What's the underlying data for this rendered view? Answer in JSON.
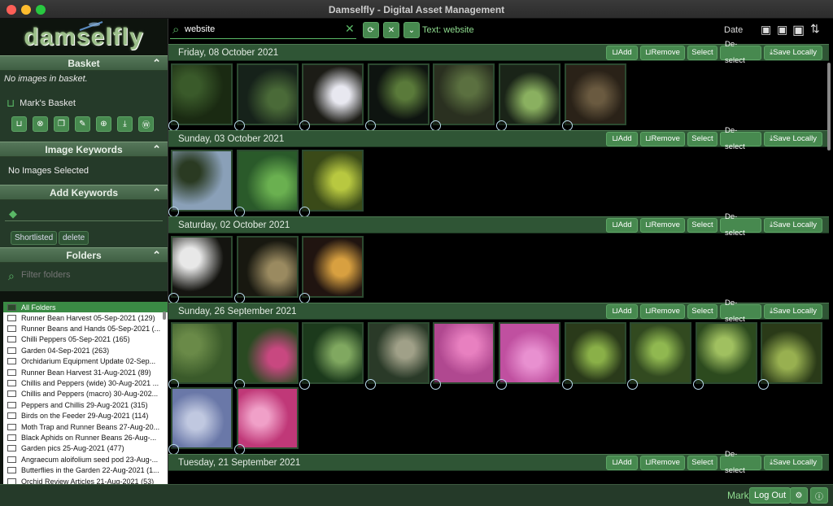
{
  "window": {
    "title": "Damselfly - Digital Asset Management"
  },
  "app": {
    "logo": "damselfly"
  },
  "basket": {
    "header": "Basket",
    "empty_text": "No images in basket.",
    "name": "Mark's Basket"
  },
  "keywords": {
    "header": "Image Keywords",
    "empty_text": "No Images Selected"
  },
  "add_keywords": {
    "header": "Add Keywords",
    "chips": [
      "Shortlisted",
      "delete"
    ]
  },
  "folders": {
    "header": "Folders",
    "filter_placeholder": "Filter folders",
    "all": "All Folders",
    "items": [
      "Runner Bean Harvest 05-Sep-2021 (129)",
      "Runner Beans and Hands 05-Sep-2021 (...",
      "Chilli Peppers 05-Sep-2021 (165)",
      "Garden 04-Sep-2021 (263)",
      "Orchidarium Equipment Update 02-Sep...",
      "Runner Bean Harvest 31-Aug-2021 (89)",
      "Chillis and Peppers (wide) 30-Aug-2021 ...",
      "Chillis and Peppers (macro) 30-Aug-202...",
      "Peppers and Chillis 29-Aug-2021 (315)",
      "Birds on the Feeder 29-Aug-2021 (114)",
      "Moth Trap and Runner Beans 27-Aug-20...",
      "Black Aphids on Runner Beans 26-Aug-...",
      "Garden pics 25-Aug-2021 (477)",
      "Angraecum aloifolium seed pod 23-Aug-...",
      "Butterflies in the Garden 22-Aug-2021 (1...",
      "Orchid Review Articles 21-Aug-2021 (53)"
    ]
  },
  "search": {
    "value": "website",
    "filter_label": "Text: website",
    "sort_label": "Date"
  },
  "group_buttons": {
    "add": "Add",
    "remove": "Remove",
    "select": "Select",
    "deselect": "De-select",
    "save": "Save Locally"
  },
  "groups": [
    {
      "date": "Friday, 08 October 2021",
      "count": 7
    },
    {
      "date": "Sunday, 03 October 2021",
      "count": 3
    },
    {
      "date": "Saturday, 02 October 2021",
      "count": 3
    },
    {
      "date": "Sunday, 26 September 2021",
      "count": 12
    },
    {
      "date": "Tuesday, 21 September 2021",
      "count": 0
    }
  ],
  "footer": {
    "user": "Mark",
    "logout": "Log Out"
  },
  "colors": {
    "accent": "#47894f",
    "header": "#2f5535",
    "sidebar": "#253a29"
  }
}
